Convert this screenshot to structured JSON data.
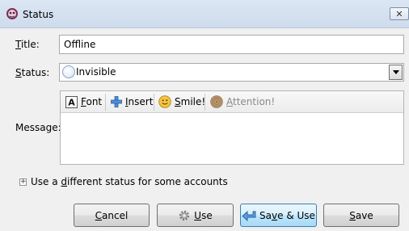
{
  "window": {
    "title": "Status",
    "close_glyph": "✕"
  },
  "form": {
    "title_label": "Title:",
    "title_label_accel": "T",
    "title_label_rest": "itle:",
    "title_value": "Offline",
    "status_label_accel": "S",
    "status_label_rest": "tatus:",
    "status_value": "Invisible",
    "message_label": "Message:"
  },
  "toolbar": {
    "font_accel": "F",
    "font_rest": "ont",
    "insert_accel": "I",
    "insert_rest": "nsert",
    "smile_accel": "S",
    "smile_rest": "mile!",
    "attention_accel": "A",
    "attention_rest": "ttention!"
  },
  "expander": {
    "pre": "Use a ",
    "accel": "d",
    "post": "ifferent status for some accounts"
  },
  "buttons": {
    "cancel_accel": "C",
    "cancel_rest": "ancel",
    "use_accel": "U",
    "use_rest": "se",
    "save_use_pre": "Sa",
    "save_use_accel": "v",
    "save_use_post": "e & Use",
    "save_accel": "S",
    "save_rest": "ave"
  },
  "icons": {
    "app": "app-icon",
    "font": "font-icon",
    "insert": "insert-plus-icon",
    "smile": "smiley-icon",
    "attention": "attention-icon",
    "use": "gear-icon",
    "save_use": "arrow-icon"
  }
}
